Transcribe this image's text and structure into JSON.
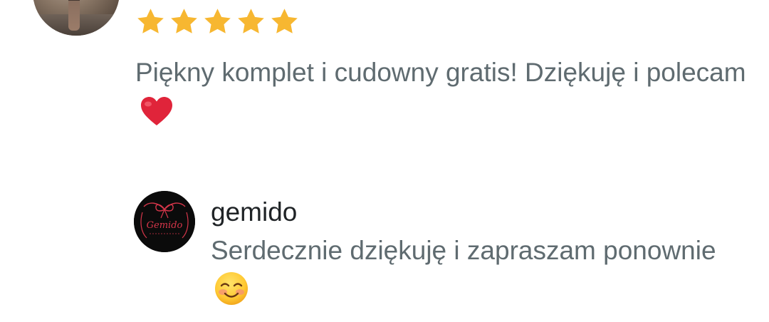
{
  "review": {
    "rating": 5,
    "rating_max": 5,
    "text": "Piękny komplet i cudowny gratis! Dziękuję i polecam",
    "emoji": "heart-emoji"
  },
  "reply": {
    "shop_name": "gemido",
    "avatar_logo_text": "Gemido",
    "text": "Serdecznie dziękuję i zapraszam ponownie",
    "emoji": "smiling-face-emoji"
  },
  "colors": {
    "star": "#F7B731",
    "body_text": "#5F6B70",
    "name_text": "#1F2326",
    "heart": "#E0243A",
    "logo_red": "#D6364A"
  }
}
